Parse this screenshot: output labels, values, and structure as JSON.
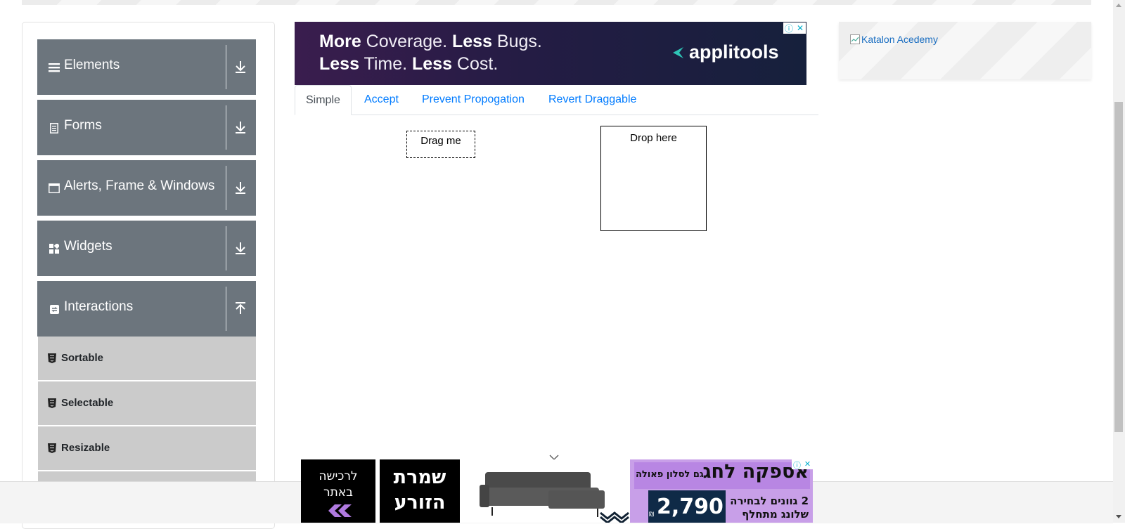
{
  "sidebar": {
    "groups": [
      {
        "label": "Elements",
        "icon": "menu-icon",
        "arrow": "download-icon"
      },
      {
        "label": "Forms",
        "icon": "form-icon",
        "arrow": "download-icon"
      },
      {
        "label": "Alerts, Frame & Windows",
        "icon": "window-icon",
        "arrow": "download-icon"
      },
      {
        "label": "Widgets",
        "icon": "widgets-icon",
        "arrow": "download-icon"
      },
      {
        "label": "Interactions",
        "icon": "interactions-icon",
        "arrow": "upload-icon"
      }
    ],
    "subitems": [
      {
        "label": "Sortable",
        "icon": "html5-icon"
      },
      {
        "label": "Selectable",
        "icon": "html5-icon"
      },
      {
        "label": "Resizable",
        "icon": "html5-icon"
      }
    ]
  },
  "ad_top": {
    "line1_a": "More",
    "line1_b": " Coverage. ",
    "line1_c": "Less",
    "line1_d": " Bugs.",
    "line2_a": "Less",
    "line2_b": " Time. ",
    "line2_c": "Less",
    "line2_d": " Cost.",
    "brand": "applitools"
  },
  "ad_side": {
    "alt_text": "Katalon Acedemy"
  },
  "tabs": [
    {
      "label": "Simple",
      "active": true
    },
    {
      "label": "Accept",
      "active": false
    },
    {
      "label": "Prevent Propogation",
      "active": false
    },
    {
      "label": "Revert Draggable",
      "active": false
    }
  ],
  "draggable": {
    "label": "Drag me"
  },
  "droppable": {
    "label": "Drop here"
  },
  "ad_bottom": {
    "block1_line1": "לרכישה",
    "block1_line2": "באתר",
    "block2_line1": "שמרת",
    "block2_line2": "הזורע",
    "headline": "אספקה לחג",
    "sub": "גם לסלון פאולה",
    "price": "2,790",
    "currency": "₪",
    "desc_line1": "2 גוונים לבחירה",
    "desc_line2": "שלונג מתחלף"
  },
  "colors": {
    "sidebar_group_bg": "#6c757d",
    "sidebar_sub_bg": "#cbcbcb",
    "link": "#007bff",
    "ad_purple": "#c89fe8"
  }
}
